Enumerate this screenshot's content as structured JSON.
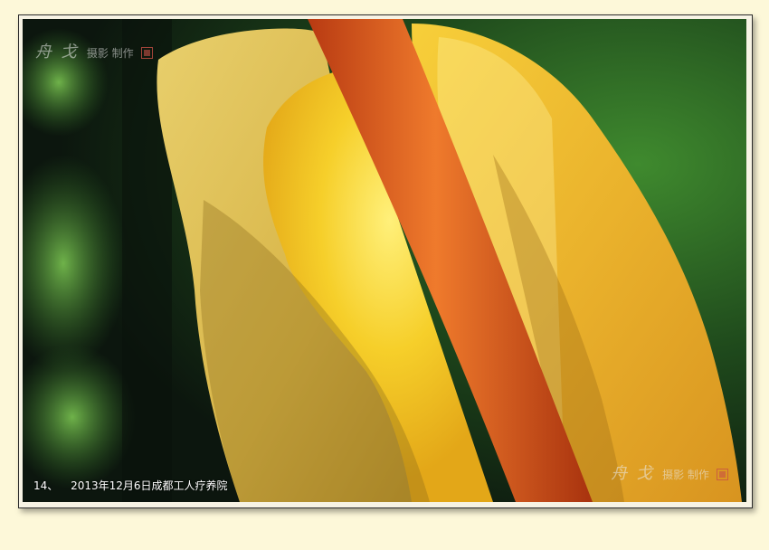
{
  "photo": {
    "subject": "backlit-leaf-photo",
    "colors": {
      "leaf_light": "#f7c92a",
      "leaf_pale": "#e6c86a",
      "stem": "#d2541a",
      "background": "#1d3a1e",
      "frame_bg": "#fdf8d9"
    }
  },
  "watermark": {
    "top_big": "舟 戈",
    "top_small": "摄影 制作",
    "bottom_big": "舟 戈",
    "bottom_small": "摄影 制作"
  },
  "caption": {
    "number": "14、",
    "text": "2013年12月6日成都工人疗养院"
  }
}
